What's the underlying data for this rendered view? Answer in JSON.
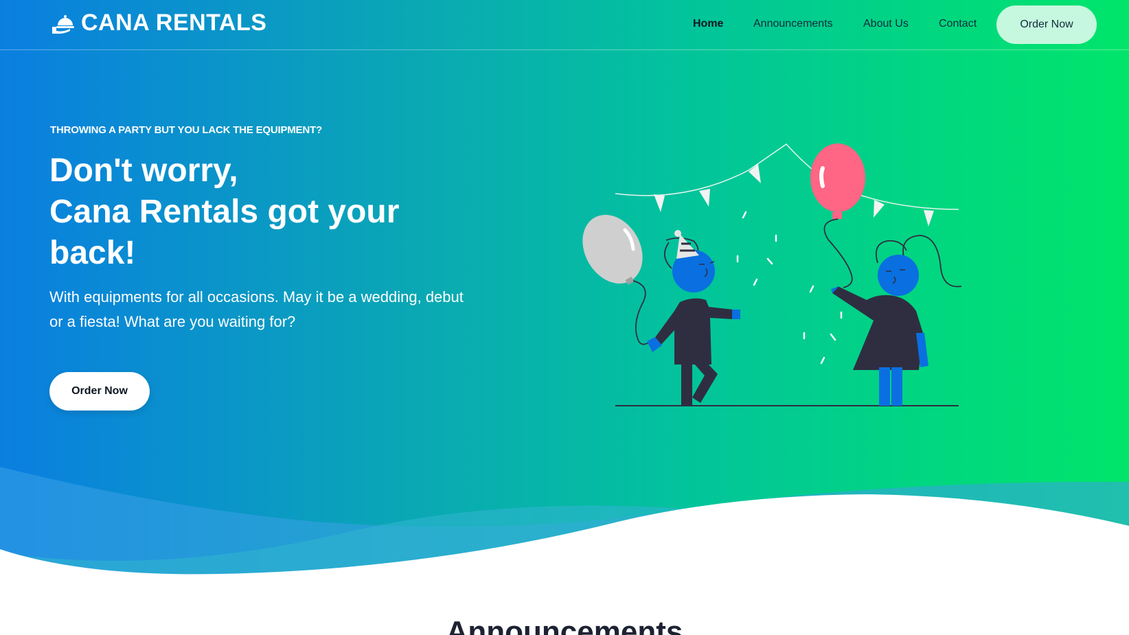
{
  "brand": {
    "name": "CANA RENTALS",
    "icon": "serving-cloche-icon"
  },
  "nav": {
    "links": [
      {
        "label": "Home",
        "active": true
      },
      {
        "label": "Announcements",
        "active": false
      },
      {
        "label": "About Us",
        "active": false
      },
      {
        "label": "Contact",
        "active": false
      }
    ],
    "order_label": "Order Now"
  },
  "hero": {
    "eyebrow": "THROWING A PARTY BUT YOU LACK THE EQUIPMENT?",
    "headline_lines": [
      "Don't worry,",
      "Cana Rentals got your",
      "back!"
    ],
    "subtext": "With equipments for all occasions. May it be a wedding, debut or a fiesta! What are you waiting for?",
    "order_label": "Order Now",
    "illustration": "party-illustration"
  },
  "announcements": {
    "title": "Announcements"
  },
  "colors": {
    "gradient_start": "#0a7fe0",
    "gradient_end": "#00e56a",
    "nav_button": "#c6f7df",
    "balloon_pink": "#ff6584",
    "figure_blue": "#0a6fe0",
    "figure_dark": "#2f2e41"
  }
}
